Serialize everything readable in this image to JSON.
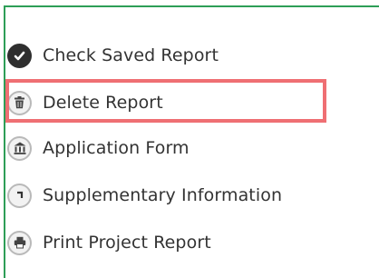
{
  "menu": {
    "items": [
      {
        "label": "Check Saved Report",
        "icon": "check-circle-icon"
      },
      {
        "label": "Delete Report",
        "icon": "trash-icon"
      },
      {
        "label": "Application Form",
        "icon": "bank-building-icon"
      },
      {
        "label": "Supplementary Information",
        "icon": "corner-arrow-icon"
      },
      {
        "label": "Print Project Report",
        "icon": "printer-icon"
      }
    ],
    "highlighted_item": "Delete Report"
  },
  "colors": {
    "panel_border": "#2e9e57",
    "highlight_border": "#ef6f73",
    "text": "#333333"
  }
}
